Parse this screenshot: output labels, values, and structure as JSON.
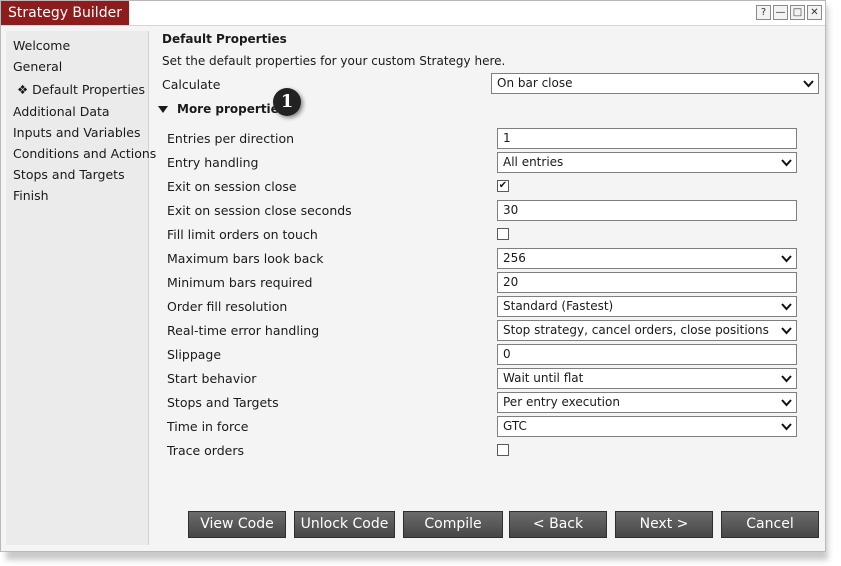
{
  "window": {
    "title": "Strategy Builder",
    "controls": {
      "help": "?",
      "minimize": "—",
      "maximize": "□",
      "close": "✕"
    }
  },
  "sidebar": {
    "items": [
      {
        "label": "Welcome"
      },
      {
        "label": "General"
      },
      {
        "label": "❖ Default Properties",
        "active": true
      },
      {
        "label": "Additional Data"
      },
      {
        "label": "Inputs and Variables"
      },
      {
        "label": "Conditions and Actions"
      },
      {
        "label": "Stops and Targets"
      },
      {
        "label": "Finish"
      }
    ]
  },
  "main": {
    "section_title": "Default Properties",
    "description": "Set the default properties for your custom Strategy here.",
    "calculate": {
      "label": "Calculate",
      "value": "On bar close"
    },
    "more_properties": {
      "label": "More properties",
      "callout": "1"
    },
    "properties": [
      {
        "label": "Entries per direction",
        "type": "text",
        "value": "1"
      },
      {
        "label": "Entry handling",
        "type": "select",
        "value": "All entries"
      },
      {
        "label": "Exit on session close",
        "type": "checkbox",
        "checked": true,
        "mark": "✔"
      },
      {
        "label": "Exit on session close seconds",
        "type": "text",
        "value": "30"
      },
      {
        "label": "Fill limit orders on touch",
        "type": "checkbox",
        "checked": false,
        "mark": ""
      },
      {
        "label": "Maximum bars look back",
        "type": "select",
        "value": "256"
      },
      {
        "label": "Minimum bars required",
        "type": "text",
        "value": "20"
      },
      {
        "label": "Order fill resolution",
        "type": "select",
        "value": "Standard (Fastest)"
      },
      {
        "label": "Real-time error handling",
        "type": "select",
        "value": "Stop strategy, cancel orders, close positions"
      },
      {
        "label": "Slippage",
        "type": "text",
        "value": "0"
      },
      {
        "label": "Start behavior",
        "type": "select",
        "value": "Wait until flat"
      },
      {
        "label": "Stops and Targets",
        "type": "select",
        "value": "Per entry execution"
      },
      {
        "label": "Time in force",
        "type": "select",
        "value": "GTC"
      },
      {
        "label": "Trace orders",
        "type": "checkbox",
        "checked": false,
        "mark": ""
      }
    ]
  },
  "footer": {
    "view_code": "View Code",
    "unlock_code": "Unlock Code",
    "compile": "Compile",
    "back": "< Back",
    "next": "Next >",
    "cancel": "Cancel"
  },
  "colors": {
    "title_accent": "#8e1c1c",
    "button_bg": "#555555"
  }
}
